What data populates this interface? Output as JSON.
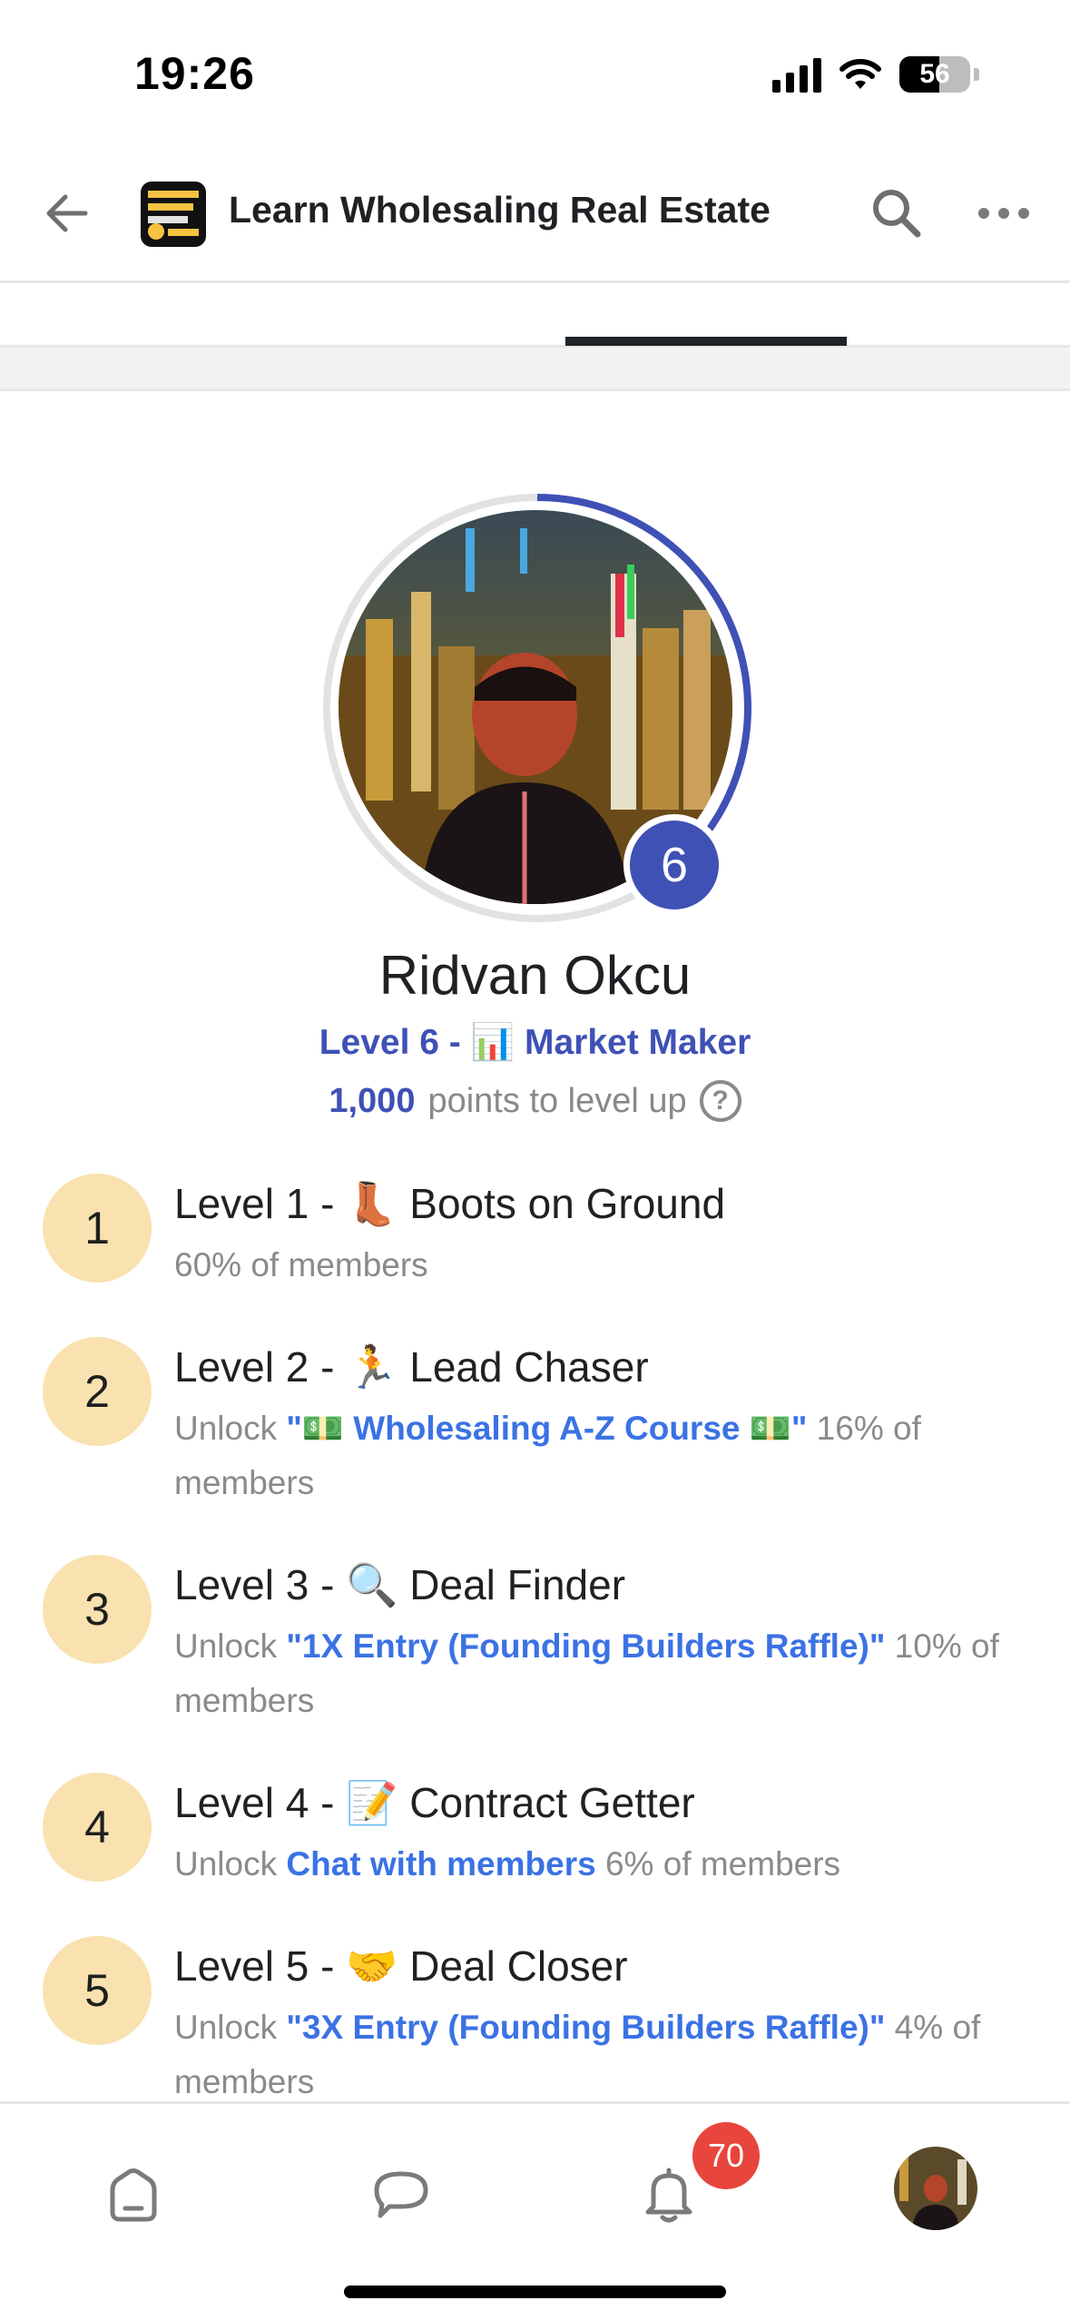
{
  "status_bar": {
    "time": "19:26",
    "battery": "56"
  },
  "header": {
    "title": "Learn Wholesaling Real Estate"
  },
  "profile": {
    "name": "Ridvan Okcu",
    "level_badge": "6",
    "level_text": "Level 6 - 📊 Market Maker",
    "points_value": "1,000",
    "points_label": "points to level up",
    "help_symbol": "?"
  },
  "levels": [
    {
      "number": "1",
      "title": "Level 1 - 👢 Boots on Ground",
      "unlock_prefix": "",
      "unlock_link": "",
      "members": "60% of members"
    },
    {
      "number": "2",
      "title": "Level 2 - 🏃 Lead Chaser",
      "unlock_prefix": "Unlock ",
      "unlock_link": "\"💵 Wholesaling A-Z Course 💵\"",
      "members": " 16% of members"
    },
    {
      "number": "3",
      "title": "Level 3 - 🔍 Deal Finder",
      "unlock_prefix": "Unlock ",
      "unlock_link": "\"1X Entry (Founding Builders Raffle)\"",
      "members": " 10% of members"
    },
    {
      "number": "4",
      "title": "Level 4 - 📝 Contract Getter",
      "unlock_prefix": "Unlock ",
      "unlock_link": "Chat with members",
      "members": " 6% of members"
    },
    {
      "number": "5",
      "title": "Level 5 - 🤝 Deal Closer",
      "unlock_prefix": "Unlock ",
      "unlock_link": "\"3X Entry (Founding Builders Raffle)\"",
      "members": " 4% of members"
    }
  ],
  "level_progress": 0.42,
  "bottom_nav": {
    "notification_count": "70"
  },
  "colors": {
    "accent": "#3f51b5",
    "link": "#3b72e4",
    "level_circle": "#f9e2b0",
    "badge": "#e8453c"
  },
  "icons": [
    "back-arrow-icon",
    "search-icon",
    "more-icon",
    "help-icon",
    "home-icon",
    "chat-icon",
    "bell-icon"
  ]
}
